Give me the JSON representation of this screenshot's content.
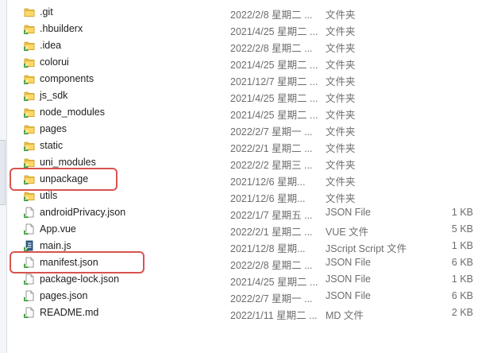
{
  "colors": {
    "folder": "#f2c744",
    "highlight": "#d9534f",
    "badge": "#3b9a38"
  },
  "files": [
    {
      "name": ".git",
      "date": "2022/2/8 星期二 ...",
      "type": "文件夹",
      "size": "",
      "icon": "folder-icon",
      "badge": false
    },
    {
      "name": ".hbuilderx",
      "date": "2021/4/25 星期二 ...",
      "type": "文件夹",
      "size": "",
      "icon": "folder-icon",
      "badge": true
    },
    {
      "name": ".idea",
      "date": "2022/2/8 星期二 ...",
      "type": "文件夹",
      "size": "",
      "icon": "folder-icon",
      "badge": true
    },
    {
      "name": "colorui",
      "date": "2021/4/25 星期二 ...",
      "type": "文件夹",
      "size": "",
      "icon": "folder-icon",
      "badge": true
    },
    {
      "name": "components",
      "date": "2021/12/7 星期二 ...",
      "type": "文件夹",
      "size": "",
      "icon": "folder-icon",
      "badge": true
    },
    {
      "name": "js_sdk",
      "date": "2021/4/25 星期二 ...",
      "type": "文件夹",
      "size": "",
      "icon": "folder-icon",
      "badge": true
    },
    {
      "name": "node_modules",
      "date": "2021/4/25 星期二 ...",
      "type": "文件夹",
      "size": "",
      "icon": "folder-icon",
      "badge": true
    },
    {
      "name": "pages",
      "date": "2022/2/7 星期一 ...",
      "type": "文件夹",
      "size": "",
      "icon": "folder-icon",
      "badge": true
    },
    {
      "name": "static",
      "date": "2022/2/1 星期二 ...",
      "type": "文件夹",
      "size": "",
      "icon": "folder-icon",
      "badge": true
    },
    {
      "name": "uni_modules",
      "date": "2022/2/2 星期三 ...",
      "type": "文件夹",
      "size": "",
      "icon": "folder-icon",
      "badge": true
    },
    {
      "name": "unpackage",
      "date": "2021/12/6 星期...",
      "type": "文件夹",
      "size": "",
      "icon": "folder-icon",
      "badge": true
    },
    {
      "name": "utils",
      "date": "2021/12/6 星期...",
      "type": "文件夹",
      "size": "",
      "icon": "folder-icon",
      "badge": true
    },
    {
      "name": "androidPrivacy.json",
      "date": "2022/1/7 星期五 ...",
      "type": "JSON File",
      "size": "1 KB",
      "icon": "file-icon",
      "badge": true
    },
    {
      "name": "App.vue",
      "date": "2022/2/1 星期二 ...",
      "type": "VUE 文件",
      "size": "5 KB",
      "icon": "file-icon",
      "badge": true
    },
    {
      "name": "main.js",
      "date": "2021/12/8 星期...",
      "type": "JScript Script 文件",
      "size": "1 KB",
      "icon": "script-icon",
      "badge": true
    },
    {
      "name": "manifest.json",
      "date": "2022/2/8 星期二 ...",
      "type": "JSON File",
      "size": "6 KB",
      "icon": "file-icon",
      "badge": true
    },
    {
      "name": "package-lock.json",
      "date": "2021/4/25 星期二 ...",
      "type": "JSON File",
      "size": "1 KB",
      "icon": "file-icon",
      "badge": true
    },
    {
      "name": "pages.json",
      "date": "2022/2/7 星期一 ...",
      "type": "JSON File",
      "size": "6 KB",
      "icon": "file-icon",
      "badge": true
    },
    {
      "name": "README.md",
      "date": "2022/1/11 星期二 ...",
      "type": "MD 文件",
      "size": "2 KB",
      "icon": "file-icon",
      "badge": true
    }
  ],
  "highlighted": [
    "unpackage",
    "manifest.json"
  ]
}
